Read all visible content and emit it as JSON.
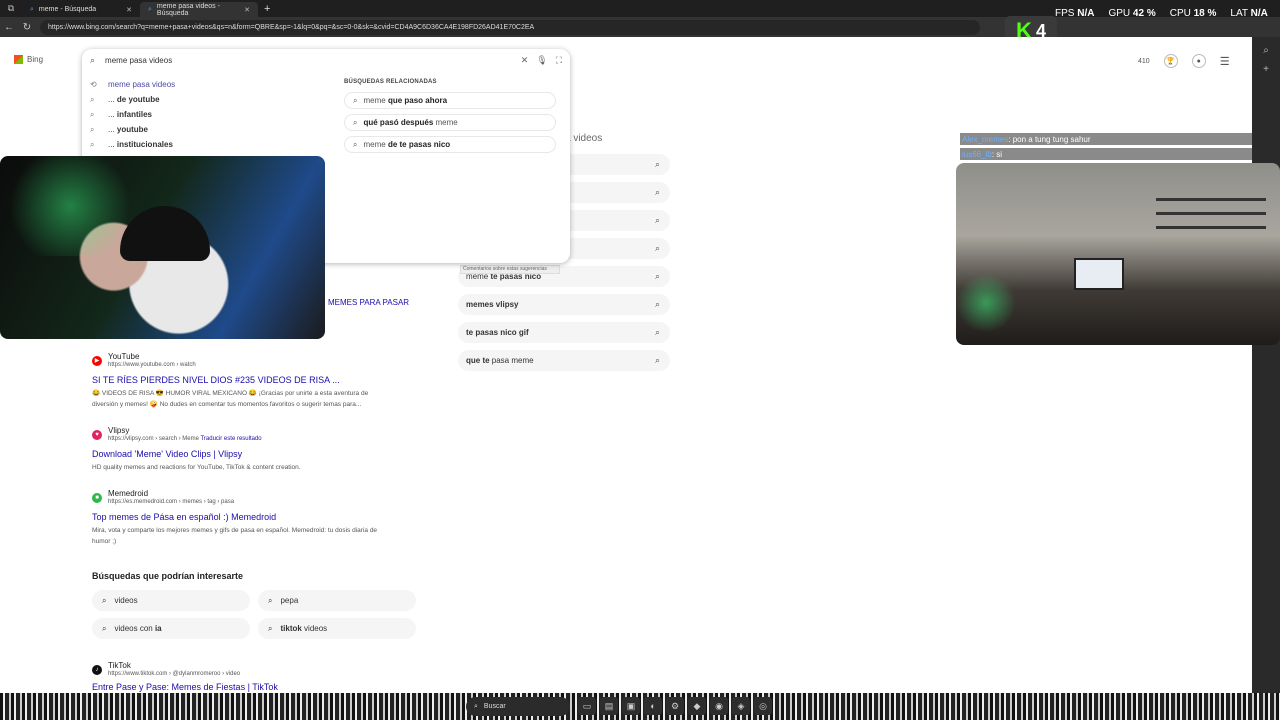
{
  "browser": {
    "tabs": [
      {
        "title": "meme - Búsqueda",
        "active": false
      },
      {
        "title": "meme pasa videos - Búsqueda",
        "active": true
      }
    ],
    "url": "https://www.bing.com/search?q=meme+pasa+videos&qs=n&form=QBRE&sp=-1&lq=0&pq=&sc=0-0&sk=&cvid=CD4A9C6D36CA4E198FD26AD41E70C2EA"
  },
  "hud": {
    "fps_label": "FPS",
    "fps_value": "N/A",
    "gpu_label": "GPU",
    "gpu_value": "42 %",
    "cpu_label": "CPU",
    "cpu_value": "18 %",
    "lat_label": "LAT",
    "lat_value": "N/A",
    "kick_count": "4"
  },
  "header": {
    "logo": "Bing",
    "points": "410"
  },
  "search": {
    "value": "meme pasa videos",
    "suggestions": [
      {
        "text": "meme pasa videos",
        "history": true,
        "prefix": "",
        "bold": ""
      },
      {
        "text": "",
        "history": false,
        "prefix": "... ",
        "bold": "de youtube"
      },
      {
        "text": "",
        "history": false,
        "prefix": "... ",
        "bold": "infantiles"
      },
      {
        "text": "",
        "history": false,
        "prefix": "... ",
        "bold": "youtube"
      },
      {
        "text": "",
        "history": false,
        "prefix": "... ",
        "bold": "institucionales"
      }
    ],
    "related_title": "BÚSQUEDAS RELACIONADAS",
    "related": [
      {
        "plain": "meme ",
        "bold": "que paso ahora",
        "after": ""
      },
      {
        "plain": "",
        "bold": "qué pasó después",
        "after": " meme"
      },
      {
        "plain": "meme ",
        "bold": "de te pasas nico",
        "after": ""
      }
    ]
  },
  "serp": {
    "heading": "a videos",
    "feedback_note": "Comentarios sobre estas sugerencias",
    "cut_title": "MEMES PARA PASAR",
    "related_pills": [
      {
        "plain": "",
        "bold": "",
        "after": ""
      },
      {
        "plain": "",
        "bold": "",
        "after": ""
      },
      {
        "plain": "",
        "bold": "",
        "after": ""
      },
      {
        "plain": "",
        "bold": "",
        "after": ""
      },
      {
        "plain": "meme ",
        "bold": "te pasas nico",
        "after": ""
      },
      {
        "plain": "",
        "bold": "memes vlipsy",
        "after": ""
      },
      {
        "plain": "",
        "bold": "te pasas nico gif",
        "after": ""
      },
      {
        "plain": "",
        "bold": "que te",
        "after": " pasa meme"
      }
    ],
    "results": [
      {
        "site": "YouTube",
        "url": "https://www.youtube.com › watch",
        "translate": "",
        "title": "SI TE RÍES PIERDES NIVEL DIOS #235 VIDEOS DE RISA ...",
        "snippet": "😂 VIDEOS DE RISA 😎 HUMOR VIRAL MEXICANO 😂 ¡Gracias por unirte a esta aventura de diversión y memes! 🤪 No dudes en comentar tus momentos favoritos o sugerir temas para...",
        "color": "#ff0000",
        "glyph": "▶"
      },
      {
        "site": "Vlipsy",
        "url": "https://vlipsy.com › search › Meme",
        "translate": "Traducir este resultado",
        "title": "Download 'Meme' Video Clips | Vlipsy",
        "snippet": "HD quality memes and reactions for YouTube, TikTok & content creation.",
        "color": "#e0245e",
        "glyph": "♥"
      },
      {
        "site": "Memedroid",
        "url": "https://es.memedroid.com › memes › tag › pasa",
        "translate": "",
        "title": "Top memes de Pása en español :) Memedroid",
        "snippet": "Mira, vota y comparte los mejores memes y gifs de pasa en español. Memedroid: tu dosis diaria de humor ;)",
        "color": "#2db84c",
        "glyph": "■"
      },
      {
        "site": "TikTok",
        "url": "https://www.tiktok.com › @dylanmromeroo › video",
        "translate": "",
        "title": "Entre Pase y Pase: Memes de Fiestas | TikTok",
        "snippet": "",
        "color": "#111111",
        "glyph": "♪"
      }
    ],
    "interest_title": "Búsquedas que podrían interesarte",
    "interest": [
      {
        "plain": "videos",
        "bold": ""
      },
      {
        "plain": "pepa",
        "bold": ""
      },
      {
        "plain": "videos con ",
        "bold": "ia"
      },
      {
        "plain": "",
        "bold": "tiktok",
        "after": " videos"
      }
    ]
  },
  "chat": [
    {
      "user": "Alex_memes",
      "msg": ": pon a tung tung sahur"
    },
    {
      "user": "lus66_lb",
      "msg": ": si"
    }
  ],
  "taskbar": {
    "search_label": "Buscar"
  }
}
